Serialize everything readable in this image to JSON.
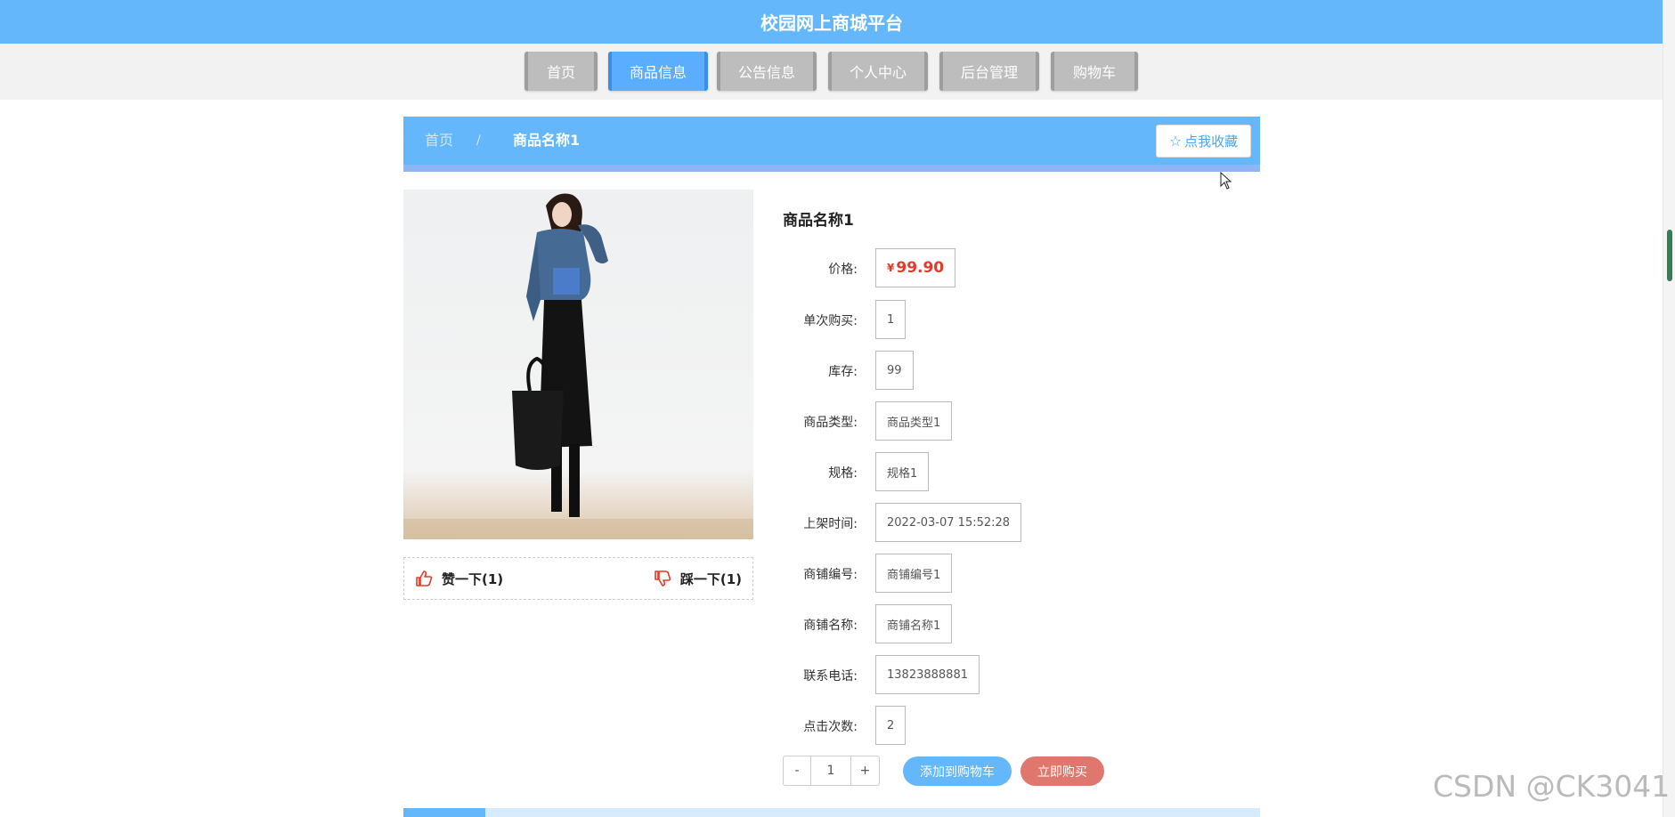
{
  "header": {
    "title": "校园网上商城平台"
  },
  "nav": {
    "items": [
      {
        "label": "首页",
        "active": false
      },
      {
        "label": "商品信息",
        "active": true
      },
      {
        "label": "公告信息",
        "active": false
      },
      {
        "label": "个人中心",
        "active": false
      },
      {
        "label": "后台管理",
        "active": false
      },
      {
        "label": "购物车",
        "active": false
      }
    ]
  },
  "breadcrumb": {
    "home": "首页",
    "separator": "/",
    "current": "商品名称1"
  },
  "favorite": {
    "icon": "star-outline-icon",
    "label": "点我收藏"
  },
  "votes": {
    "like": {
      "icon": "thumbs-up-icon",
      "label": "赞一下(1)"
    },
    "dislike": {
      "icon": "thumbs-down-icon",
      "label": "踩一下(1)"
    }
  },
  "product": {
    "title": "商品名称1",
    "price_symbol": "¥",
    "price": "99.90",
    "fields": [
      {
        "label": "价格:",
        "value": ""
      },
      {
        "label": "单次购买:",
        "value": "1"
      },
      {
        "label": "库存:",
        "value": "99"
      },
      {
        "label": "商品类型:",
        "value": "商品类型1"
      },
      {
        "label": "规格:",
        "value": "规格1"
      },
      {
        "label": "上架时间:",
        "value": "2022-03-07 15:52:28"
      },
      {
        "label": "商铺编号:",
        "value": "商铺编号1"
      },
      {
        "label": "商铺名称:",
        "value": "商铺名称1"
      },
      {
        "label": "联系电话:",
        "value": "13823888881"
      },
      {
        "label": "点击次数:",
        "value": "2"
      }
    ]
  },
  "quantity": {
    "minus": "-",
    "value": "1",
    "plus": "+"
  },
  "actions": {
    "add_to_cart": "添加到购物车",
    "buy_now": "立即购买"
  },
  "watermark": "CSDN @CK3041",
  "colors": {
    "primary": "#63b7fa",
    "buy": "#e0776e",
    "price": "#e23b2a"
  }
}
